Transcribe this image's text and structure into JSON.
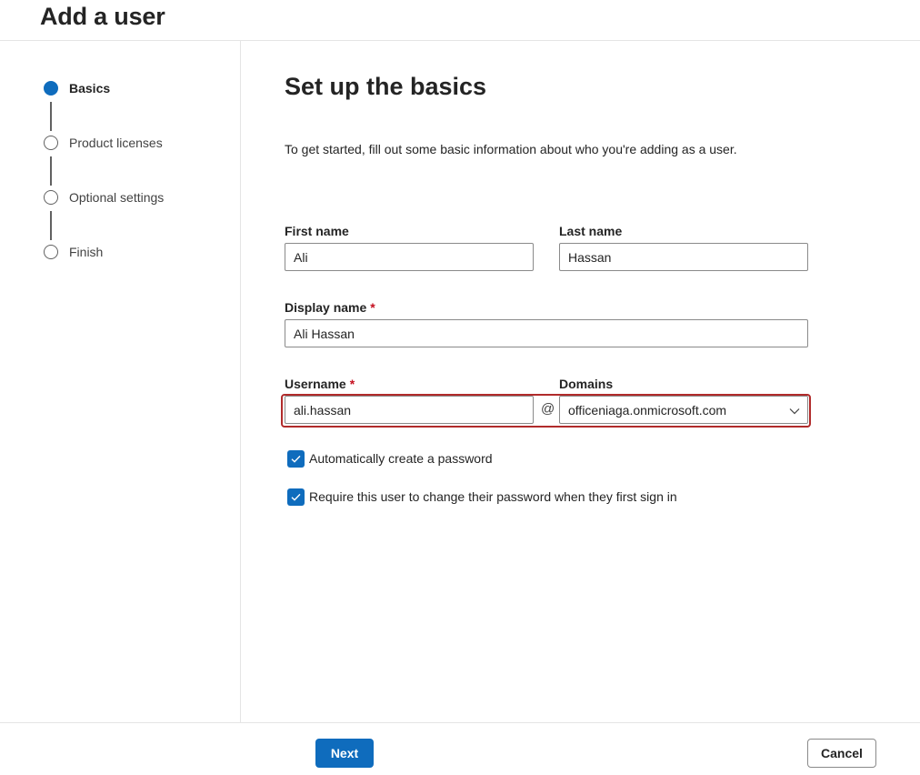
{
  "page": {
    "title": "Add a user"
  },
  "steps": [
    {
      "label": "Basics",
      "state": "current"
    },
    {
      "label": "Product licenses",
      "state": "pending"
    },
    {
      "label": "Optional settings",
      "state": "pending"
    },
    {
      "label": "Finish",
      "state": "pending"
    }
  ],
  "form": {
    "title": "Set up the basics",
    "intro": "To get started, fill out some basic information about who you're adding as a user.",
    "first_name": {
      "label": "First name",
      "value": "Ali"
    },
    "last_name": {
      "label": "Last name",
      "value": "Hassan"
    },
    "display_name": {
      "label": "Display name",
      "required_marker": "*",
      "value": "Ali Hassan"
    },
    "username": {
      "label": "Username",
      "required_marker": "*",
      "value": "ali.hassan"
    },
    "at_symbol": "@",
    "domains": {
      "label": "Domains",
      "value": "officeniaga.onmicrosoft.com"
    },
    "checkboxes": [
      {
        "label": "Automatically create a password",
        "checked": true
      },
      {
        "label": "Require this user to change their password when they first sign in",
        "checked": true
      }
    ]
  },
  "footer": {
    "next_label": "Next",
    "cancel_label": "Cancel"
  },
  "colors": {
    "accent": "#0f6cbd",
    "required": "#c50f1f",
    "highlight": "#b12b2b"
  },
  "icons": {
    "domains_select": "chevron-down-icon",
    "checkbox": "checkmark-icon"
  }
}
